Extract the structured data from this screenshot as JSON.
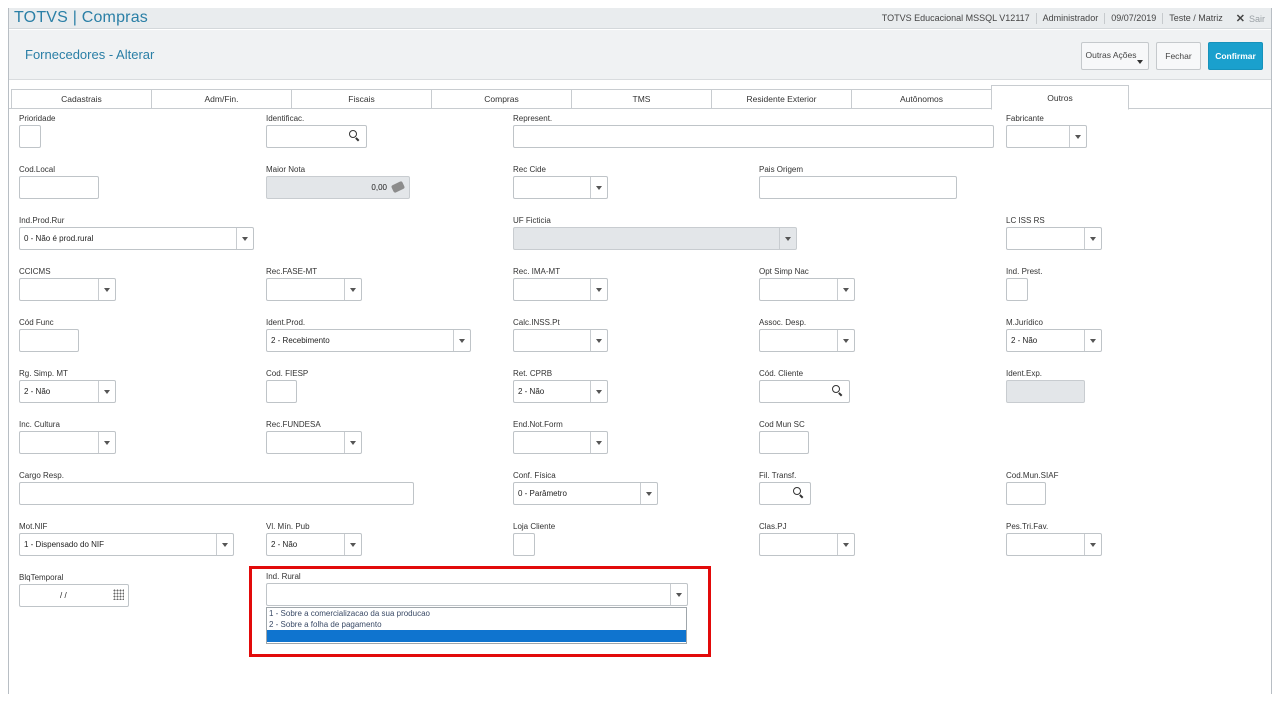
{
  "app": {
    "title": "TOTVS | Compras"
  },
  "topbar": {
    "environment": "TOTVS Educacional MSSQL V12117",
    "user": "Administrador",
    "date": "09/07/2019",
    "company": "Teste / Matriz",
    "logout": "Sair"
  },
  "header": {
    "title": "Fornecedores - Alterar",
    "other_actions": "Outras Ações",
    "close": "Fechar",
    "confirm": "Confirmar",
    "confirm_color": "#1aa0cd"
  },
  "tabs": [
    {
      "label": "Cadastrais"
    },
    {
      "label": "Adm/Fin."
    },
    {
      "label": "Fiscais"
    },
    {
      "label": "Compras"
    },
    {
      "label": "TMS"
    },
    {
      "label": "Residente Exterior"
    },
    {
      "label": "Autônomos"
    },
    {
      "label": "Outros",
      "active": true
    }
  ],
  "fields": {
    "prioridade": {
      "label": "Prioridade"
    },
    "identificac": {
      "label": "Identificac."
    },
    "represent": {
      "label": "Represent."
    },
    "fabricante": {
      "label": "Fabricante"
    },
    "cod_local": {
      "label": "Cod.Local"
    },
    "maior_nota": {
      "label": "Maior Nota",
      "value": "0,00"
    },
    "rec_cide": {
      "label": "Rec Cide"
    },
    "pais_origem": {
      "label": "Pais Origem"
    },
    "ind_prod_rur": {
      "label": "Ind.Prod.Rur",
      "value": "0 - Não é prod.rural"
    },
    "uf_ficticia": {
      "label": "UF Ficticia"
    },
    "lc_iss_rs": {
      "label": "LC ISS RS"
    },
    "ccicms": {
      "label": "CCICMS"
    },
    "rec_fase_mt": {
      "label": "Rec.FASE-MT"
    },
    "rec_ima_mt": {
      "label": "Rec. IMA-MT"
    },
    "opt_simp_nac": {
      "label": "Opt Simp Nac"
    },
    "ind_prest": {
      "label": "Ind. Prest."
    },
    "cod_func": {
      "label": "Cód Func"
    },
    "ident_prod": {
      "label": "Ident.Prod.",
      "value": "2 - Recebimento"
    },
    "calc_inss_pt": {
      "label": "Calc.INSS.Pt"
    },
    "assoc_desp": {
      "label": "Assoc. Desp."
    },
    "m_juridico": {
      "label": "M.Jurídico",
      "value": "2 - Não"
    },
    "rg_simp_mt": {
      "label": "Rg. Simp. MT",
      "value": "2 - Não"
    },
    "cod_fiesp": {
      "label": "Cod. FIESP"
    },
    "ret_cprb": {
      "label": "Ret. CPRB",
      "value": "2 - Não"
    },
    "cod_cliente": {
      "label": "Cód. Cliente"
    },
    "ident_exp": {
      "label": "Ident.Exp."
    },
    "inc_cultura": {
      "label": "Inc. Cultura"
    },
    "rec_fundesa": {
      "label": "Rec.FUNDESA"
    },
    "end_not_form": {
      "label": "End.Not.Form"
    },
    "cod_mun_sc": {
      "label": "Cod Mun SC"
    },
    "cargo_resp": {
      "label": "Cargo Resp."
    },
    "conf_fisica": {
      "label": "Conf. Física",
      "value": "0 - Parâmetro"
    },
    "fil_transf": {
      "label": "Fil. Transf."
    },
    "cod_mun_siaf": {
      "label": "Cod.Mun.SIAF"
    },
    "mot_nif": {
      "label": "Mot.NIF",
      "value": "1 - Dispensado do NIF"
    },
    "vl_min_pub": {
      "label": "Vl. Mín. Pub",
      "value": "2 - Não"
    },
    "loja_cliente": {
      "label": "Loja Cliente"
    },
    "clas_pj": {
      "label": "Clas.PJ"
    },
    "pes_tri_fav": {
      "label": "Pes.Tri.Fav."
    },
    "blq_temporal": {
      "label": "BlqTemporal",
      "value": "/ /"
    },
    "ind_rural": {
      "label": "Ind. Rural",
      "options": [
        "1 - Sobre a comercializacao da sua producao",
        "2 - Sobre a folha de pagamento",
        ""
      ]
    }
  },
  "colors": {
    "highlight": "#e20a0a",
    "title_blue": "#2a7fa6",
    "selected_option": "#0f74cf"
  }
}
